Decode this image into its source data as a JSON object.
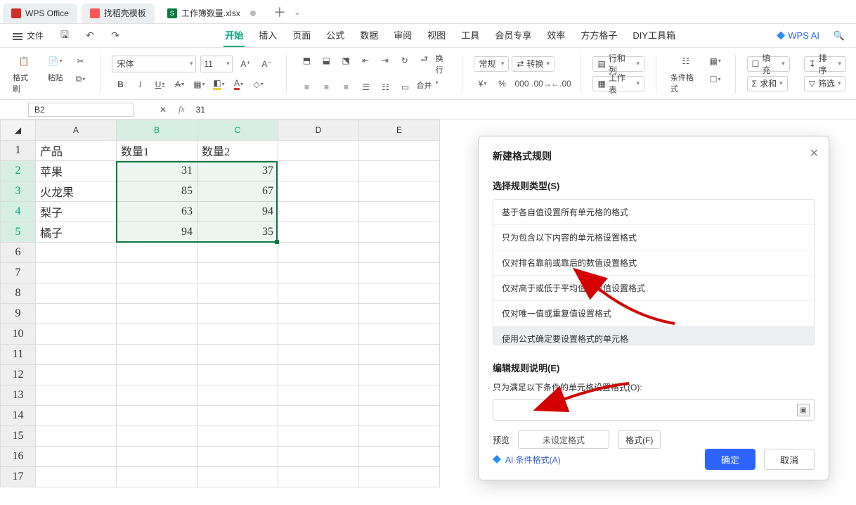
{
  "tabs": {
    "office_label": "WPS Office",
    "template_label": "找稻壳模板",
    "workbook_label": "工作簿数量.xlsx"
  },
  "menubar": {
    "file": "文件",
    "items": [
      "开始",
      "插入",
      "页面",
      "公式",
      "数据",
      "审阅",
      "视图",
      "工具",
      "会员专享",
      "效率",
      "方方格子",
      "DIY工具箱"
    ],
    "ai": "WPS AI"
  },
  "ribbon": {
    "format_painter": "格式刷",
    "paste": "粘贴",
    "font_name": "宋体",
    "font_size": "11",
    "wrap": "换行",
    "merge": "合并",
    "num_format": "常规",
    "convert": "转换",
    "rowcol": "行和列",
    "worksheet": "工作表",
    "cond_fmt": "条件格式",
    "fill": "填充",
    "sort": "排序",
    "sum": "求和",
    "filter": "筛选"
  },
  "namebox": "B2",
  "formula_value": "31",
  "columns": [
    "A",
    "B",
    "C",
    "D",
    "E"
  ],
  "sheet": {
    "headers": [
      "产品",
      "数量1",
      "数量2"
    ],
    "rows": [
      {
        "p": "苹果",
        "q1": 31,
        "q2": 37
      },
      {
        "p": "火龙果",
        "q1": 85,
        "q2": 67
      },
      {
        "p": "梨子",
        "q1": 63,
        "q2": 94
      },
      {
        "p": "橘子",
        "q1": 94,
        "q2": 35
      }
    ]
  },
  "dialog": {
    "title": "新建格式规则",
    "section_type": "选择规则类型(S)",
    "rules": [
      "基于各自值设置所有单元格的格式",
      "只为包含以下内容的单元格设置格式",
      "仅对排名靠前或靠后的数值设置格式",
      "仅对高于或低于平均值的数值设置格式",
      "仅对唯一值或重复值设置格式",
      "使用公式确定要设置格式的单元格"
    ],
    "selected_rule_index": 5,
    "section_edit": "编辑规则说明(E)",
    "cond_label": "只为满足以下条件的单元格设置格式(O):",
    "preview_label": "预览",
    "preview_value": "未设定格式",
    "format_btn": "格式(F)",
    "ai_link": "AI 条件格式(A)",
    "ok": "确定",
    "cancel": "取消"
  },
  "chart_data": {
    "type": "table",
    "columns": [
      "产品",
      "数量1",
      "数量2"
    ],
    "rows": [
      [
        "苹果",
        31,
        37
      ],
      [
        "火龙果",
        85,
        67
      ],
      [
        "梨子",
        63,
        94
      ],
      [
        "橘子",
        94,
        35
      ]
    ],
    "selected_range": "B2:C5"
  }
}
